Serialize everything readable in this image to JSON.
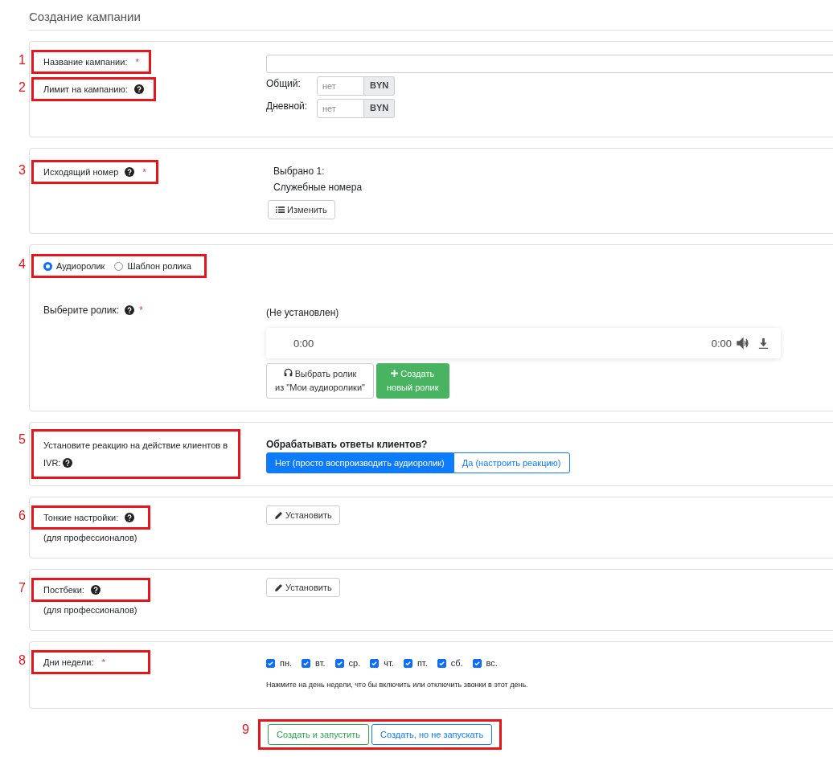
{
  "page_title": "Создание кампании",
  "campaign_name": {
    "annotation": "1",
    "label": "Название кампании:",
    "required_mark": "*"
  },
  "limit": {
    "annotation": "2",
    "label": "Лимит на кампанию:",
    "help": true,
    "rows": [
      {
        "label": "Общий:",
        "placeholder": "нет",
        "currency": "BYN"
      },
      {
        "label": "Дневной:",
        "placeholder": "нет",
        "currency": "BYN"
      }
    ]
  },
  "caller_number": {
    "annotation": "3",
    "label": "Исходящий номер",
    "help": true,
    "required_mark": "*",
    "selected_count": "Выбрано 1:",
    "selection": "Служебные номера",
    "change_button": "Изменить"
  },
  "audio": {
    "annotation": "4",
    "source_options": [
      {
        "label": "Аудиоролик",
        "selected": true
      },
      {
        "label": "Шаблон ролика",
        "selected": false
      }
    ],
    "label": "Выберите ролик:",
    "help": true,
    "required_mark": "*",
    "status": "(Не установлен)",
    "player": {
      "current_time": "0:00",
      "duration": "0:00"
    },
    "buttons": [
      {
        "kind": "choose",
        "lines": [
          "Выбрать ролик",
          "из \"Мои аудиоролики\""
        ]
      },
      {
        "kind": "create",
        "lines": [
          "Создать",
          "новый ролик"
        ]
      }
    ]
  },
  "ivr": {
    "annotation": "5",
    "label": "Установите реакцию на действие клиентов в IVR:",
    "help": true,
    "question": "Обрабатывать ответы клиентов?",
    "options": [
      {
        "label": "Нет (просто воспроизводить аудиоролик)",
        "selected": true
      },
      {
        "label": "Да (настроить реакцию)",
        "selected": false
      }
    ]
  },
  "fine_settings": {
    "annotation": "6",
    "label": "Тонкие настройки:",
    "help": true,
    "note": "(для профессионалов)",
    "button": "Установить"
  },
  "postbacks": {
    "annotation": "7",
    "label": "Постбеки:",
    "help": true,
    "note": "(для профессионалов)",
    "button": "Установить"
  },
  "weekdays": {
    "annotation": "8",
    "label": "Дни недели:",
    "required_mark": "*",
    "days": [
      {
        "label": "пн.",
        "checked": true
      },
      {
        "label": "вт.",
        "checked": true
      },
      {
        "label": "ср.",
        "checked": true
      },
      {
        "label": "чт.",
        "checked": true
      },
      {
        "label": "пт.",
        "checked": true
      },
      {
        "label": "сб.",
        "checked": true
      },
      {
        "label": "вс.",
        "checked": true
      }
    ],
    "hint": "Нажмите на день недели, что бы включить или отключить звонки в этот день."
  },
  "actions": {
    "annotation": "9",
    "buttons": [
      {
        "kind": "success",
        "label": "Создать и запустить"
      },
      {
        "kind": "primary",
        "label": "Создать, но не запускать"
      }
    ]
  }
}
